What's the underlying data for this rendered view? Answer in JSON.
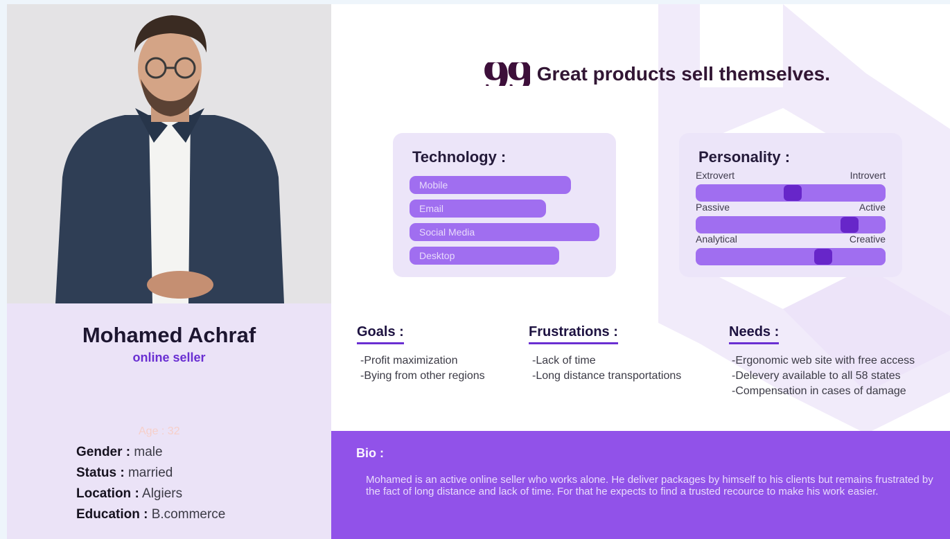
{
  "quote": {
    "mark": "99",
    "text": "Great products sell themselves."
  },
  "profile": {
    "name": "Mohamed Achraf",
    "role": "online seller",
    "age": "Age : 32",
    "fields": [
      {
        "key": "Gender :",
        "value": "male"
      },
      {
        "key": "Status :",
        "value": "married"
      },
      {
        "key": "Location :",
        "value": "Algiers"
      },
      {
        "key": "Education :",
        "value": "B.commerce"
      }
    ]
  },
  "technology": {
    "title": "Technology :",
    "items": [
      {
        "label": "Mobile",
        "level": 0.85
      },
      {
        "label": "Email",
        "level": 0.72
      },
      {
        "label": "Social Media",
        "level": 1.0
      },
      {
        "label": "Desktop",
        "level": 0.79
      }
    ]
  },
  "personality": {
    "title": "Personality :",
    "traits": [
      {
        "left": "Extrovert",
        "right": "Introvert",
        "value": 0.51
      },
      {
        "left": "Passive",
        "right": "Active",
        "value": 0.81
      },
      {
        "left": "Analytical",
        "right": "Creative",
        "value": 0.67
      }
    ]
  },
  "goals": {
    "title": "Goals :",
    "items": [
      "-Profit maximization",
      "-Bying from other regions"
    ]
  },
  "frustrations": {
    "title": "Frustrations :",
    "items": [
      "-Lack of time",
      "-Long distance transportations"
    ]
  },
  "needs": {
    "title": "Needs :",
    "items": [
      "-Ergonomic web site with free access",
      "-Delevery available to all 58 states",
      "-Compensation in cases of damage"
    ]
  },
  "bio": {
    "title": "Bio :",
    "text": "Mohamed is an active online seller who works alone. He deliver packages by himself to his clients but remains frustrated by the fact of long distance and lack of time. For that he expects to find a trusted recource to make his work easier."
  },
  "colors": {
    "accent": "#9152e9",
    "knob": "#6726c9",
    "bar": "#a06ef0",
    "panel": "#ebe3f7",
    "heading": "#6a2fd2"
  },
  "icons": {
    "quote": "quote-icon",
    "avatar": "person-photo"
  }
}
